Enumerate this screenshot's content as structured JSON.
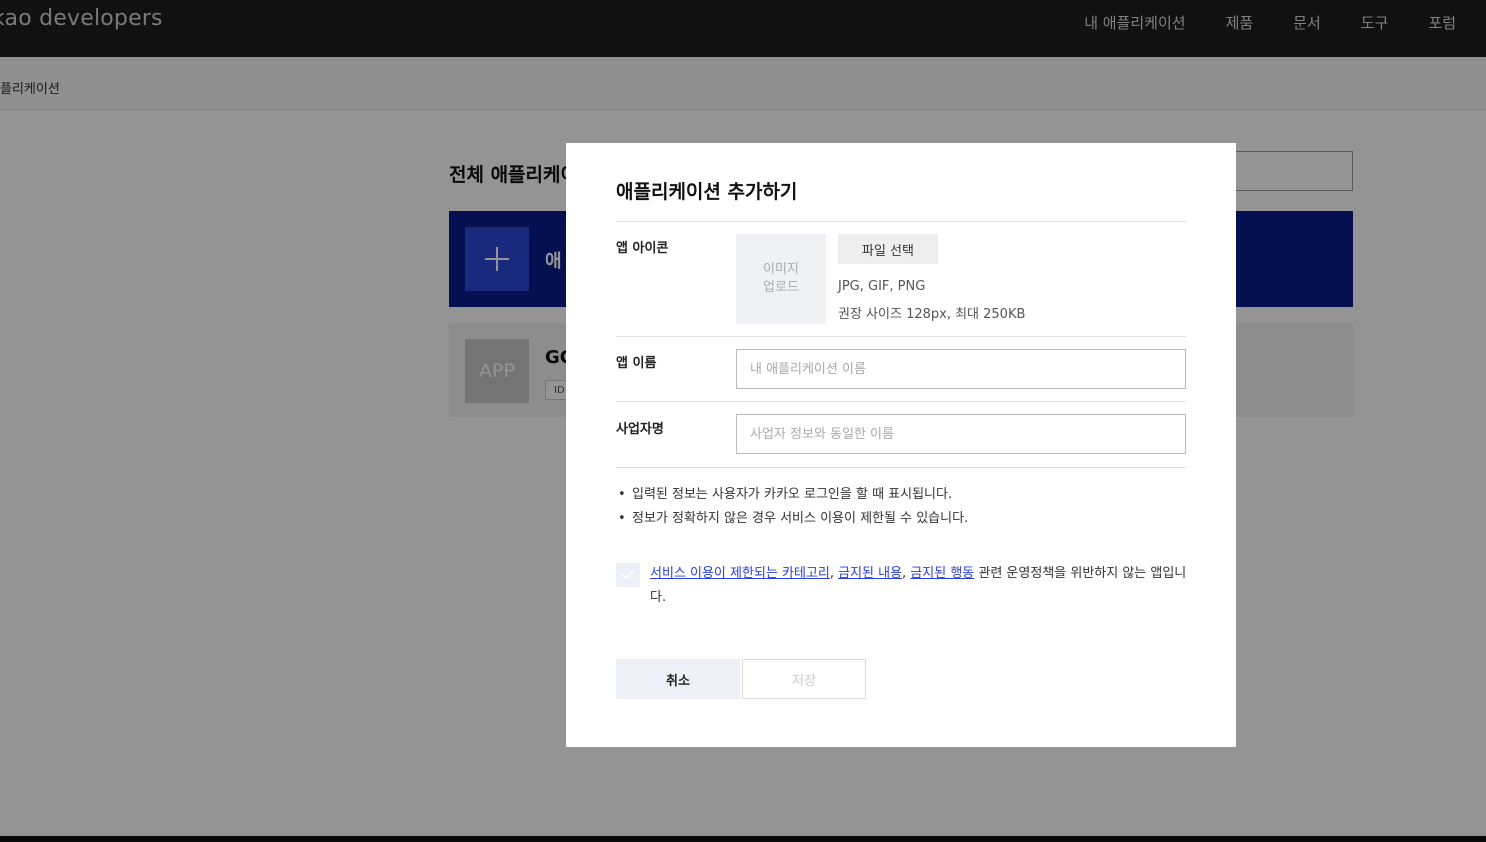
{
  "header": {
    "logo": "kao developers",
    "nav": [
      "내 애플리케이션",
      "제품",
      "문서",
      "도구",
      "포럼"
    ]
  },
  "breadcrumb": "플리케이션",
  "page": {
    "title": "전체 애플리케이",
    "add_label": "애",
    "app": {
      "thumb_text": "APP",
      "name": "GC",
      "id_label": "ID"
    }
  },
  "modal": {
    "title": "애플리케이션 추가하기",
    "icon_row": {
      "label": "앱 아이콘",
      "upload_line1": "이미지",
      "upload_line2": "업로드",
      "file_button": "파일 선택",
      "formats": "JPG, GIF, PNG",
      "size_hint": "권장 사이즈 128px, 최대 250KB"
    },
    "name_row": {
      "label": "앱 이름",
      "placeholder": "내 애플리케이션 이름",
      "value": ""
    },
    "company_row": {
      "label": "사업자명",
      "placeholder": "사업자 정보와 동일한 이름",
      "value": ""
    },
    "notes": [
      "입력된 정보는 사용자가 카카오 로그인을 할 때 표시됩니다.",
      "정보가 정확하지 않은 경우 서비스 이용이 제한될 수 있습니다."
    ],
    "agreement": {
      "checked": false,
      "link1": "서비스 이용이 제한되는 카테고리",
      "sep1": ", ",
      "link2": "금지된 내용",
      "sep2": ", ",
      "link3": "금지된 행동",
      "tail": " 관련 운영정책을 위반하지 않는 앱입니다."
    },
    "buttons": {
      "cancel": "취소",
      "save": "저장"
    },
    "colors": {
      "link": "#2a40d9",
      "banner": "#0a1c8c"
    }
  }
}
